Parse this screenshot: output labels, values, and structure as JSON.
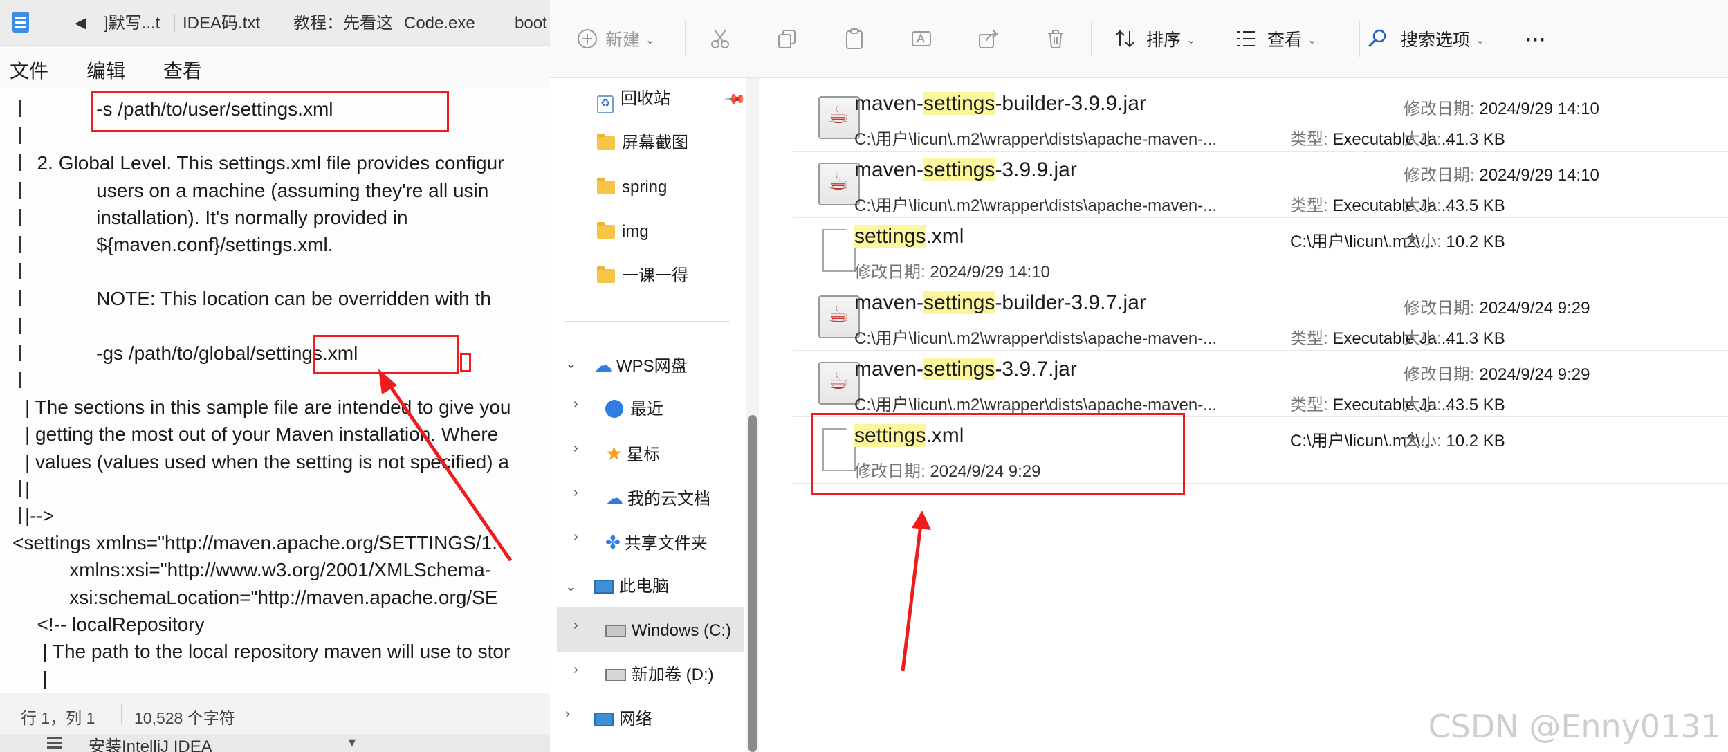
{
  "notepad": {
    "tabs": [
      "]默写...t",
      "IDEA码.txt",
      "教程：先看这",
      "Code.exe",
      "boot"
    ],
    "menu": [
      "文件",
      "编辑",
      "查看"
    ],
    "lines": [
      "             -s /path/to/user/settings.xml",
      "",
      "  2. Global Level. This settings.xml file provides configur",
      "             users on a machine (assuming they're all usin",
      "             installation). It's normally provided in",
      "             ${maven.conf}/settings.xml.",
      "",
      "             NOTE: This location can be overridden with th",
      "",
      "             -gs /path/to/global/settings.xml",
      "",
      "| The sections in this sample file are intended to give you",
      "| getting the most out of your Maven installation. Where",
      "| values (values used when the setting is not specified) a",
      "|",
      "|-->",
      "<settings xmlns=\"http://maven.apache.org/SETTINGS/1.",
      "        xmlns:xsi=\"http://www.w3.org/2001/XMLSchema-",
      "        xsi:schemaLocation=\"http://maven.apache.org/SE",
      "  <!-- localRepository",
      "   | The path to the local repository maven will use to stor",
      "   |"
    ],
    "status": {
      "position": "行 1，列 1",
      "chars": "10,528 个字符"
    },
    "bottom_label": "安装IntelliJ IDEA"
  },
  "explorer": {
    "toolbar": {
      "new": "新建",
      "sort": "排序",
      "view": "查看",
      "search_options": "搜索选项",
      "more": "···"
    },
    "nav": {
      "recycle": "回收站",
      "folders": [
        "屏幕截图",
        "spring",
        "img",
        "一课一得"
      ],
      "wps": "WPS网盘",
      "recent": "最近",
      "starred": "星标",
      "cloud_docs": "我的云文档",
      "shared": "共享文件夹",
      "this_pc": "此电脑",
      "drive_c": "Windows (C:)",
      "drive_d": "新加卷 (D:)",
      "network": "网络"
    },
    "labels": {
      "type": "类型: ",
      "size": "大小: ",
      "modified": "修改日期: "
    },
    "files": [
      {
        "pre": "maven-",
        "hl": "settings",
        "post": "-builder-3.9.9.jar",
        "path": "C:\\用户\\licun\\.m2\\wrapper\\dists\\apache-maven-...",
        "type": "Executable Ja...",
        "modified": "2024/9/29 14:10",
        "size": "41.3 KB"
      },
      {
        "pre": "maven-",
        "hl": "settings",
        "post": "-3.9.9.jar",
        "path": "C:\\用户\\licun\\.m2\\wrapper\\dists\\apache-maven-...",
        "type": "Executable Ja...",
        "modified": "2024/9/29 14:10",
        "size": "43.5 KB"
      },
      {
        "pre": "",
        "hl": "settings",
        "post": ".xml",
        "path": "C:\\用户\\licun\\.m2\\...",
        "modified": "2024/9/29 14:10",
        "size": "10.2 KB"
      },
      {
        "pre": "maven-",
        "hl": "settings",
        "post": "-builder-3.9.7.jar",
        "path": "C:\\用户\\licun\\.m2\\wrapper\\dists\\apache-maven-...",
        "type": "Executable Ja...",
        "modified": "2024/9/24 9:29",
        "size": "41.3 KB"
      },
      {
        "pre": "maven-",
        "hl": "settings",
        "post": "-3.9.7.jar",
        "path": "C:\\用户\\licun\\.m2\\wrapper\\dists\\apache-maven-...",
        "type": "Executable Ja...",
        "modified": "2024/9/24 9:29",
        "size": "43.5 KB"
      },
      {
        "pre": "",
        "hl": "settings",
        "post": ".xml",
        "path": "C:\\用户\\licun\\.m2\\...",
        "modified": "2024/9/24 9:29",
        "size": "10.2 KB"
      }
    ],
    "watermark": "CSDN @Enny0131"
  },
  "annotation_color": "#ee1c1c"
}
